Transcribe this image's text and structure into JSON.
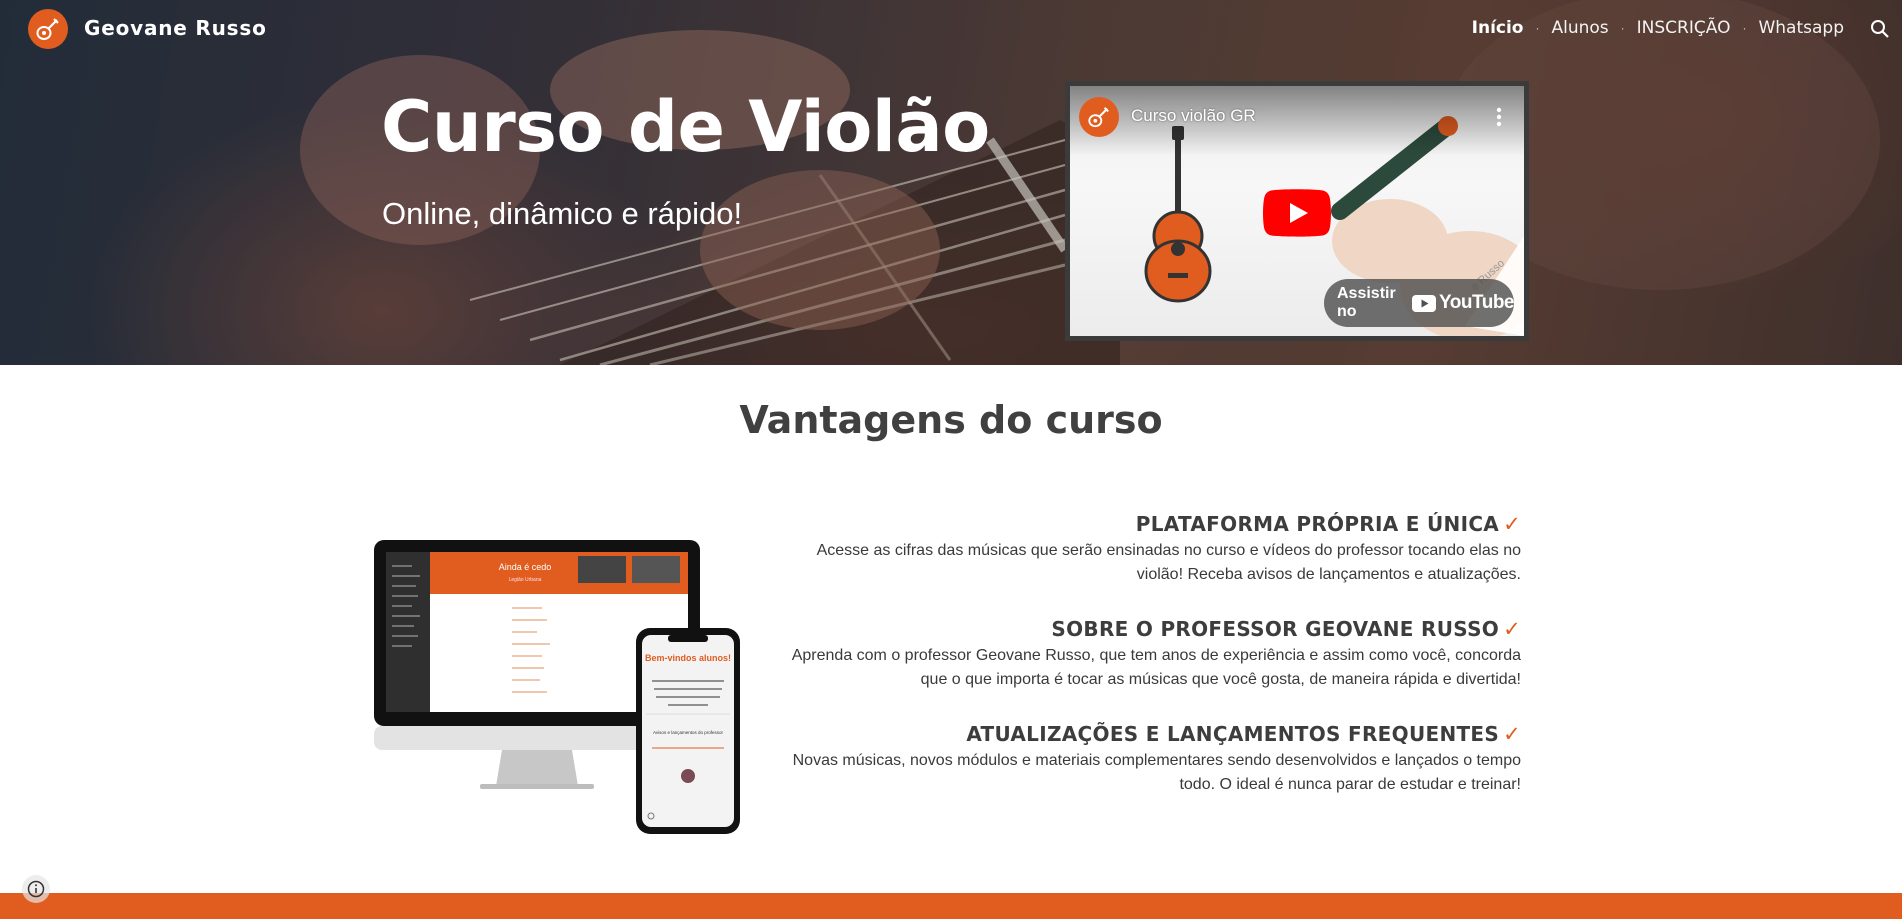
{
  "header": {
    "site_title": "Geovane Russo",
    "nav": [
      {
        "label": "Início",
        "active": true
      },
      {
        "label": "Alunos",
        "active": false
      },
      {
        "label": "INSCRIÇÃO",
        "active": false
      },
      {
        "label": "Whatsapp",
        "active": false
      }
    ],
    "search_icon": "search-icon"
  },
  "hero": {
    "title": "Curso de Violão",
    "subtitle": "Online, dinâmico e rápido!"
  },
  "video": {
    "title": "Curso violão GR",
    "watch_label": "Assistir no",
    "youtube_word": "YouTube",
    "watermark": "e Russo"
  },
  "section": {
    "title": "Vantagens do curso"
  },
  "features": [
    {
      "title": "PLATAFORMA PRÓPRIA E ÚNICA",
      "line1": "Acesse as cifras das músicas que serão ensinadas no curso e vídeos do professor tocando elas no",
      "line2": "violão! Receba avisos de lançamentos e atualizações."
    },
    {
      "title": "SOBRE O PROFESSOR GEOVANE RUSSO",
      "line1": "Aprenda com o professor Geovane Russo, que tem anos de experiência e assim como você, concorda",
      "line2": "que o que importa é tocar as músicas que você gosta, de maneira rápida e divertida!"
    },
    {
      "title": "ATUALIZAÇÕES E LANÇAMENTOS FREQUENTES",
      "line1": "Novas músicas, novos módulos e materiais complementares sendo desenvolvidos e lançados o tempo",
      "line2": "todo. O ideal é nunca parar de estudar e treinar!"
    }
  ],
  "check_mark": "✓",
  "mockup": {
    "desktop_title": "Ainda é cedo",
    "desktop_subtitle": "Legião Urbana",
    "phone_welcome": "Bem-vindos alunos!",
    "phone_text": "Para encontrar músicas, use a Lupa de Pesquisa no canto direito superior ou a barra à esquerda",
    "phone_section": "Avisos e lançamentos do professor"
  },
  "colors": {
    "accent": "#e05d1f",
    "heading": "#404040"
  }
}
